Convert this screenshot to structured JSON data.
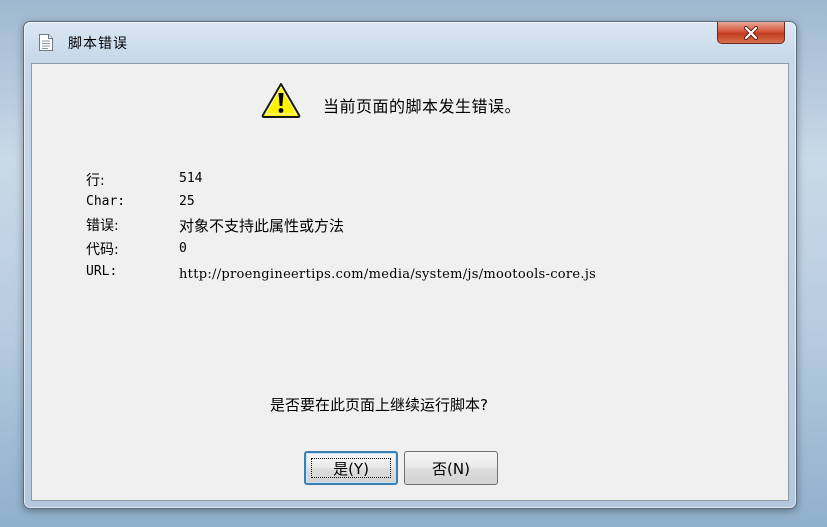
{
  "dialog": {
    "title": "脚本错误",
    "headline": "当前页面的脚本发生错误。",
    "rows": [
      {
        "label": "行:",
        "value": "514"
      },
      {
        "label": "Char:",
        "value": "25"
      },
      {
        "label": "错误:",
        "value": "对象不支持此属性或方法"
      },
      {
        "label": "代码:",
        "value": "0"
      },
      {
        "label": "URL:",
        "value": "http://proengineertips.com/media/system/js/mootools-core.js"
      }
    ],
    "question": "是否要在此页面上继续运行脚本?",
    "yes_button": "是(Y)",
    "no_button": "否(N)"
  },
  "icons": {
    "title": "document-icon",
    "warning": "warning-icon",
    "close": "close-icon"
  },
  "colors": {
    "close_button": "#c8432a",
    "warning_fill": "#fff200",
    "client_background": "#f0f0f0",
    "default_button_border": "#3c7fb1"
  }
}
